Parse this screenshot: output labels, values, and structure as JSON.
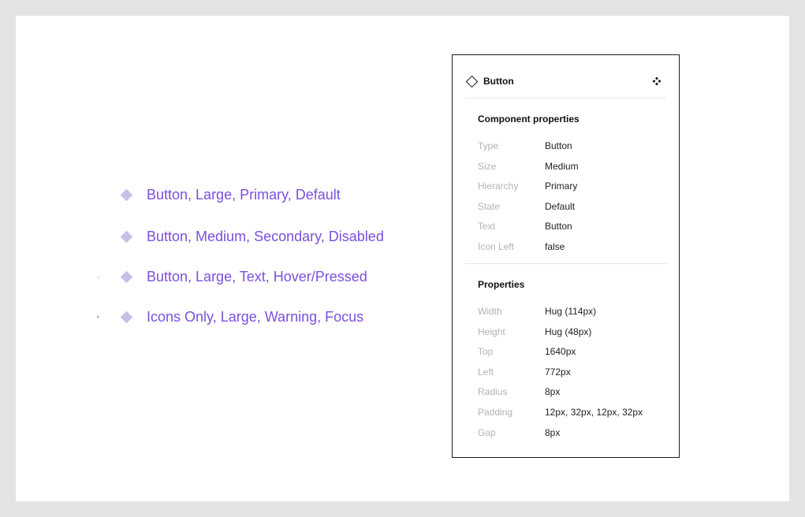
{
  "variants": [
    "Button, Large, Primary, Default",
    "Button, Medium, Secondary, Disabled",
    "Button, Large, Text, Hover/Pressed",
    "Icons Only, Large, Warning, Focus"
  ],
  "panel": {
    "title": "Button",
    "component_section": "Component properties",
    "component_properties": [
      {
        "key": "Type",
        "value": "Button"
      },
      {
        "key": "Size",
        "value": "Medium"
      },
      {
        "key": "Hierarchy",
        "value": "Primary"
      },
      {
        "key": "State",
        "value": "Default"
      },
      {
        "key": "Text",
        "value": "Button"
      },
      {
        "key": "Icon Left",
        "value": "false"
      }
    ],
    "properties_section": "Properties",
    "properties": [
      {
        "key": "Width",
        "value": "Hug (114px)"
      },
      {
        "key": "Height",
        "value": "Hug (48px)"
      },
      {
        "key": "Top",
        "value": "1640px"
      },
      {
        "key": "Left",
        "value": "772px"
      },
      {
        "key": "Radius",
        "value": "8px"
      },
      {
        "key": "Padding",
        "value": "12px, 32px, 12px, 32px"
      },
      {
        "key": "Gap",
        "value": "8px"
      }
    ]
  },
  "colors": {
    "variant_text": "#7b4fe0",
    "variant_diamond": "#c8bfe6",
    "panel_border": "#1a1a1a"
  }
}
